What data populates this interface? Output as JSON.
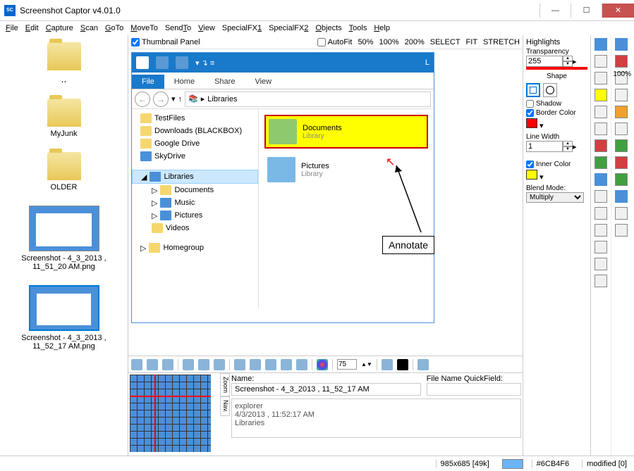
{
  "titlebar": {
    "title": "Screenshot Captor v4.01.0"
  },
  "menubar": [
    "File",
    "Edit",
    "Capture",
    "Scan",
    "GoTo",
    "MoveTo",
    "SendTo",
    "View",
    "SpecialFX1",
    "SpecialFX2",
    "Objects",
    "Tools",
    "Help"
  ],
  "left_thumbs": {
    "dots": "..",
    "folder1": "MyJunk",
    "folder2": "OLDER",
    "shot1": "Screenshot - 4_3_2013 , 11_51_20 AM.png",
    "shot2": "Screenshot - 4_3_2013 , 11_52_17 AM.png"
  },
  "toolbar1": {
    "thumbnail_panel": "Thumbnail Panel",
    "autofit": "AutoFit",
    "zoom50": "50%",
    "zoom100": "100%",
    "zoom200": "200%",
    "select": "SELECT",
    "fit": "FIT",
    "stretch": "STRETCH"
  },
  "explorer": {
    "ribbon": {
      "file": "File",
      "home": "Home",
      "share": "Share",
      "view": "View"
    },
    "breadcrumb_icon": "📚",
    "breadcrumb": "Libraries",
    "tree": {
      "testfiles": "TestFiles",
      "downloads": "Downloads (BLACKBOX)",
      "gdrive": "Google Drive",
      "skydrive": "SkyDrive",
      "libraries": "Libraries",
      "documents": "Documents",
      "music": "Music",
      "pictures": "Pictures",
      "videos": "Videos",
      "homegroup": "Homegroup"
    },
    "content": {
      "doc_title": "Documents",
      "doc_sub": "Library",
      "pic_title": "Pictures",
      "pic_sub": "Library"
    },
    "annotate": "Annotate"
  },
  "highlights_panel": {
    "title": "Highlights",
    "transparency_label": "Transparency",
    "transparency_value": "255",
    "shape_label": "Shape",
    "shadow": "Shadow",
    "border_color": "Border Color",
    "line_width_label": "Line Width",
    "line_width_value": "1",
    "inner_color": "Inner Color",
    "blend_mode_label": "Blend Mode:",
    "blend_mode_value": "Multiply"
  },
  "toolbar2_spinner": "75",
  "bottom": {
    "name_label": "Name:",
    "name_value": "Screenshot - 4_3_2013 , 11_52_17 AM",
    "quickfield_label": "File Name QuickField:",
    "quickfield_value": "",
    "line1": "explorer",
    "line2": "4/3/2013 , 11:52:17 AM",
    "line3": "Libraries",
    "zoom_tab": "Zoom",
    "nav_tab": "Nav."
  },
  "far_zoom": "100%",
  "status": {
    "dims": "985x685 [49k]",
    "color": "#6CB4F6",
    "modified": "modified [0]"
  }
}
